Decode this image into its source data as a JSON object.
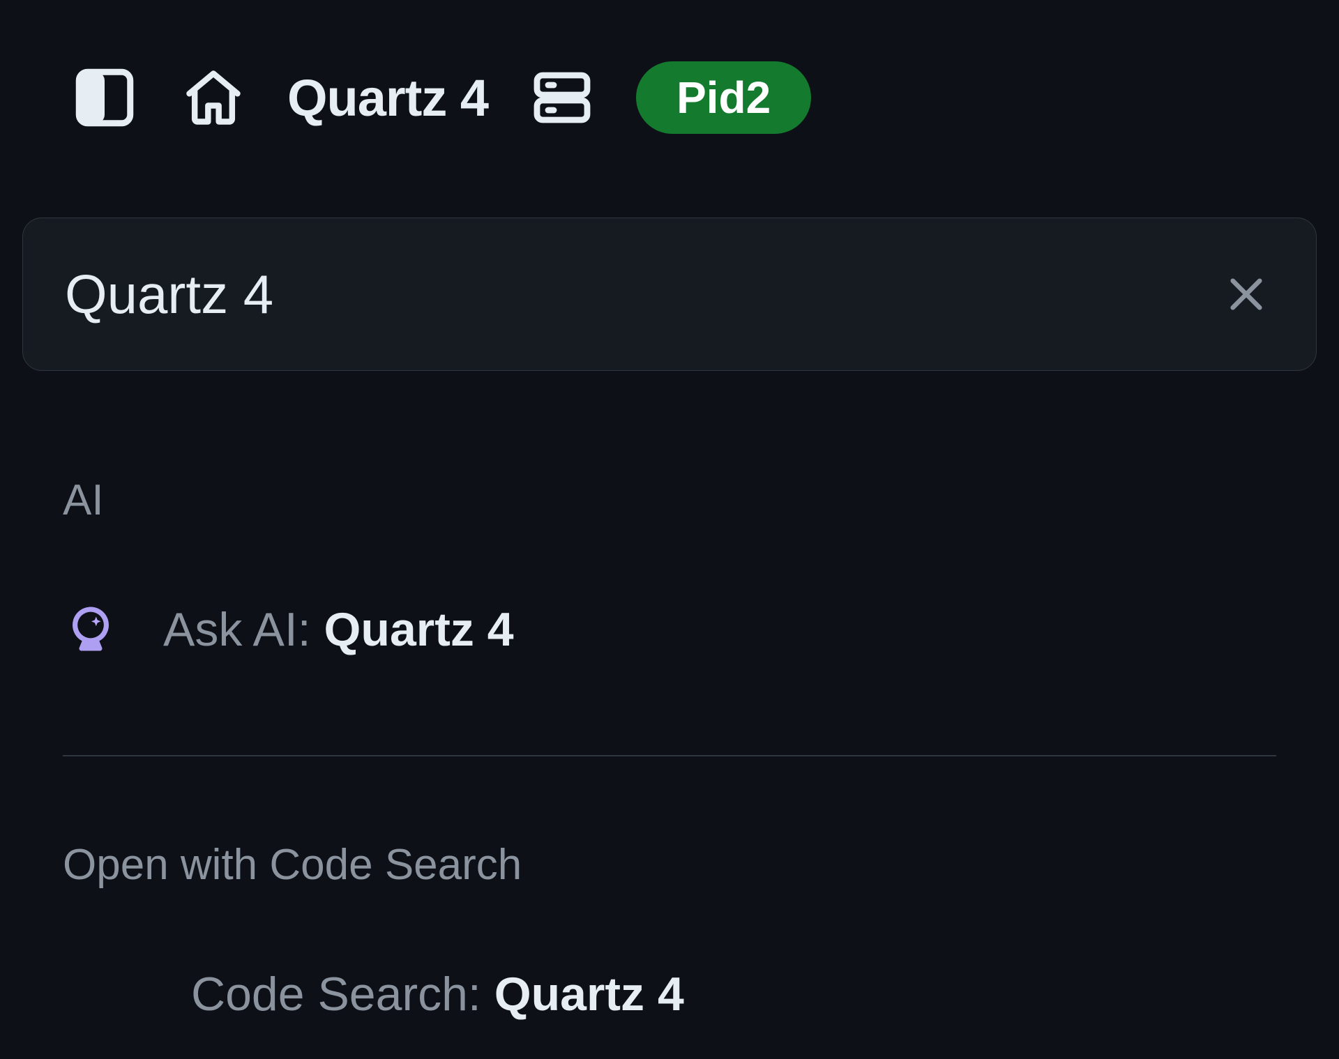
{
  "toolbar": {
    "title": "Quartz 4",
    "badge": "Pid2"
  },
  "search": {
    "value": "Quartz 4"
  },
  "sections": {
    "ai": {
      "heading": "AI",
      "row_label": "Ask AI: ",
      "row_query": "Quartz 4"
    },
    "code_search": {
      "heading": "Open with Code Search",
      "row_label": "Code Search: ",
      "row_query": "Quartz 4"
    }
  }
}
